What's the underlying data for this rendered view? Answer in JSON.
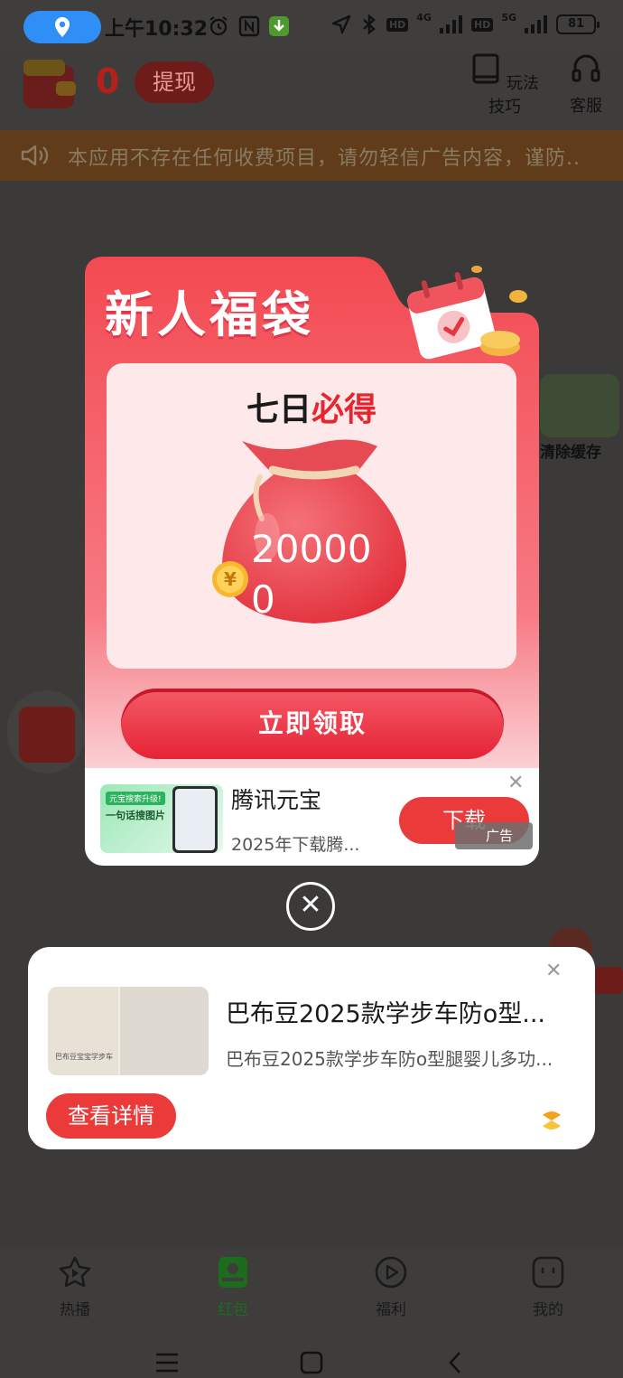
{
  "status_bar": {
    "time": "上午10:32",
    "network_1": "4G",
    "network_2": "5G",
    "hd": "HD",
    "battery": "81"
  },
  "header": {
    "coin_count": "0",
    "withdraw_label": "提现",
    "tips_label": "玩法技巧",
    "service_label": "客服"
  },
  "notice": {
    "text": "本应用不存在任何收费项目，请勿轻信广告内容，谨防.."
  },
  "side": {
    "clear_cache_label": "清除缓存"
  },
  "new_user_popup": {
    "title": "新人福袋",
    "subtitle_prefix": "七日",
    "subtitle_emphasis": "必得",
    "amount": "200000",
    "coin_symbol": "¥",
    "claim_label": "立即领取",
    "ad": {
      "title": "腾讯元宝",
      "description": "2025年下载腾...",
      "download_label": "下载",
      "ad_badge": "广告",
      "thumb_tag": "元宝搜索升级!",
      "thumb_headline": "一句话搜图片"
    }
  },
  "product_ad": {
    "title": "巴布豆2025款学步车防o型...",
    "description": "巴布豆2025款学步车防o型腿婴儿多功...",
    "detail_label": "查看详情",
    "thumb_caption": "巴布豆宝宝学步车"
  },
  "bottom_nav": {
    "items": [
      {
        "label": "热播"
      },
      {
        "label": "红包"
      },
      {
        "label": "福利"
      },
      {
        "label": "我的"
      }
    ],
    "active_index": 1
  },
  "colors": {
    "accent_red": "#ea3a3a",
    "popup_red": "#f04354",
    "active_green": "#1d6b1d"
  }
}
